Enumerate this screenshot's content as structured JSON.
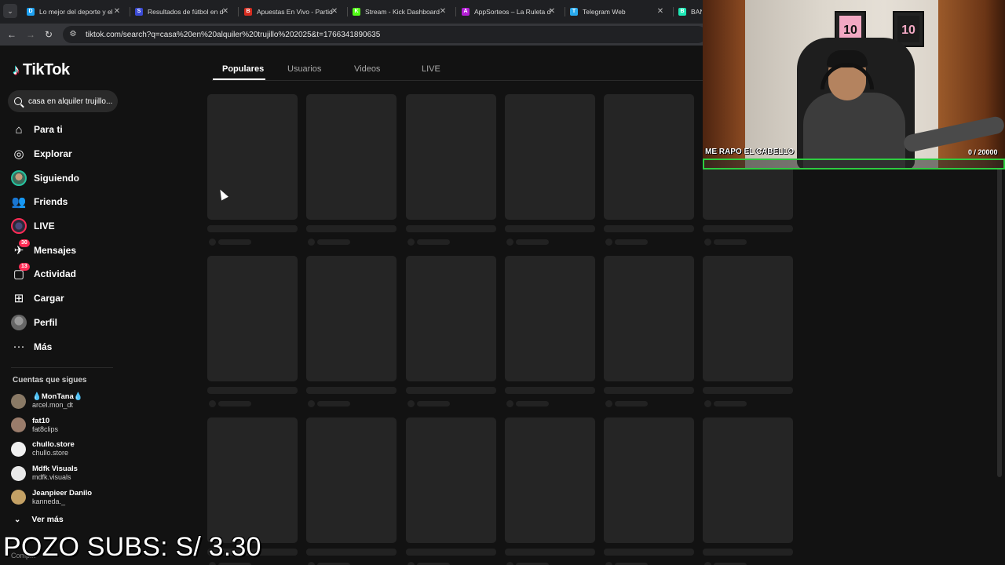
{
  "browser": {
    "tabs": [
      {
        "label": "Lo mejor del deporte y el",
        "color": "#1da1f2",
        "glyph": "D"
      },
      {
        "label": "Resultados de fútbol en d",
        "color": "#3b4bd6",
        "glyph": "S"
      },
      {
        "label": "Apuestas En Vivo - Partid",
        "color": "#d62d20",
        "glyph": "B"
      },
      {
        "label": "Stream - Kick Dashboard",
        "color": "#53fc18",
        "glyph": "K"
      },
      {
        "label": "AppSorteos – La Ruleta d",
        "color": "#b31fd6",
        "glyph": "A"
      },
      {
        "label": "Telegram Web",
        "color": "#2aabee",
        "glyph": "T"
      },
      {
        "label": "BAN",
        "color": "#1de9b6",
        "glyph": "B"
      }
    ],
    "url": "tiktok.com/search?q=casa%20en%20alquiler%20trujillo%202025&t=1766341890635"
  },
  "tiktok": {
    "logo": "TikTok",
    "search": {
      "value": "casa en alquiler trujillo..."
    },
    "nav": [
      {
        "label": "Para ti",
        "icon": "home-icon",
        "glyph": "⌂"
      },
      {
        "label": "Explorar",
        "icon": "compass-icon",
        "glyph": "◎"
      },
      {
        "label": "Siguiendo",
        "icon": "following-avatar-icon",
        "glyph": ""
      },
      {
        "label": "Friends",
        "icon": "friends-icon",
        "glyph": "👥"
      },
      {
        "label": "LIVE",
        "icon": "live-icon",
        "glyph": ""
      },
      {
        "label": "Mensajes",
        "icon": "messages-icon",
        "glyph": "✈",
        "badge": "30"
      },
      {
        "label": "Actividad",
        "icon": "activity-icon",
        "glyph": "▢",
        "badge": "13"
      },
      {
        "label": "Cargar",
        "icon": "upload-icon",
        "glyph": "⊞"
      },
      {
        "label": "Perfil",
        "icon": "profile-avatar-icon",
        "glyph": ""
      },
      {
        "label": "Más",
        "icon": "more-icon",
        "glyph": "···"
      }
    ],
    "following_title": "Cuentas que sigues",
    "following": [
      {
        "name": "💧MonTana💧",
        "handle": "arcel.mon_dt",
        "avatar_color": "#8a7a66"
      },
      {
        "name": "fat10",
        "handle": "fat8clips",
        "avatar_color": "#9a7c6b"
      },
      {
        "name": "chullo.store",
        "handle": "chullo.store",
        "avatar_color": "#f0f0f0"
      },
      {
        "name": "Mdfk Visuals",
        "handle": "mdfk.visuals",
        "avatar_color": "#e8e8e8"
      },
      {
        "name": "Jeanpieer Danilo",
        "handle": "kanneda._",
        "avatar_color": "#c4a165"
      }
    ],
    "see_more": "Ver más",
    "footer": "Comp...",
    "content_tabs": [
      "Populares",
      "Usuarios",
      "Videos",
      "LIVE"
    ],
    "active_tab": "Populares"
  },
  "webcam": {
    "caption": "ME RAPO EL CABELLO",
    "counter": "0  / 20000",
    "progress": 0
  },
  "overlay": {
    "pozo_text": "POZO SUBS: S/ 3.30"
  }
}
